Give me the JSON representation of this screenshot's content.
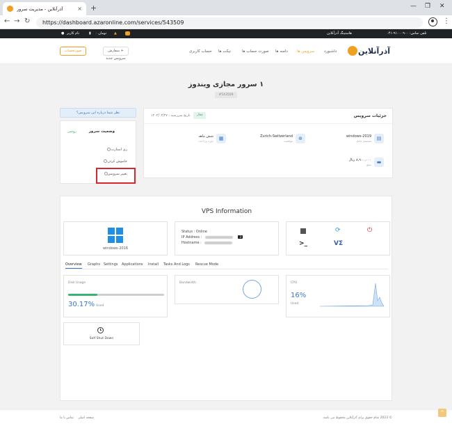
{
  "browser": {
    "tab_title": "آذرآنلاین - مدیریت سرور",
    "new_tab": "+",
    "url": "https://dashboard.azaronline.com/services/543509"
  },
  "topbar": {
    "phone": "تلفن تماس: ۹۱۰۰۰۹۰۰-۰۴۱",
    "hosting": "هاستینگ آذرآنلاین",
    "cart_count": "۰",
    "balance": "۰ تومان",
    "user": "نام کاربر"
  },
  "header": {
    "logo_text": "آذرآنلاین",
    "nav": [
      "داشبورد",
      "سرویس ها",
      "دامنه ها",
      "صورت حساب ها",
      "تیکت ها",
      "حساب کاربری"
    ],
    "order_button": "+ سفارش سرویس جدید",
    "invoice_button": "صورتحساب"
  },
  "page": {
    "title": "۱ سرور مجازی ویندوز",
    "service_id": "#543509"
  },
  "sidebar": {
    "help_button": "نظر شما درباره این سرویس؟",
    "status_title": "وضعیت سرور",
    "status_value": "روشن",
    "actions": [
      "ری استارت",
      "خاموش کردن",
      "تغییر سرویس"
    ]
  },
  "details": {
    "title": "جزئیات سرویس",
    "status_badge": "فعال",
    "date_label": "تاریخ سررسید : ۱۴۰۲/۰۳/۲۷",
    "specs": [
      {
        "value": "windows-2019",
        "label": "سیستم عامل",
        "icon": "os-icon"
      },
      {
        "value": "Zurich-Switzerland",
        "label": "موقعیت",
        "icon": "location-icon"
      },
      {
        "value": "شش ماهه",
        "label": "دوره پرداخت",
        "icon": "calendar-icon"
      },
      {
        "value": "۸,۹۰۰,۰۰۰ ریال",
        "label": "مبلغ",
        "icon": "money-icon"
      }
    ]
  },
  "vps": {
    "title": "VPS Information",
    "os_name": "windows-2016",
    "status_label": "Status :",
    "status_value": "Online",
    "ip_label": "IP Address :",
    "host_label": "Hostname :",
    "ip_badge": "3",
    "tabs": [
      "Overview",
      "Graphs",
      "Settings",
      "Applications",
      "Install",
      "Tasks And Logs",
      "Rescue Mode"
    ],
    "disk": {
      "label": "Disk Usage",
      "value": "30.17%",
      "unit": "Used",
      "fraction": 0.3017
    },
    "bandwidth": {
      "label": "Bandwidth"
    },
    "cpu": {
      "label": "CPU",
      "value": "16%",
      "unit": "Used"
    },
    "shutdown": {
      "label": "Self Shut Down"
    },
    "controls": {
      "console": ">_",
      "vnc": "VΣ"
    }
  },
  "footer": {
    "copyright": "© 2023 تمام حقوق برای آذرآنلاین محفوظ می باشد.",
    "links": [
      "صفحه اصلی",
      "تماس با ما"
    ],
    "scroll_top": "^"
  },
  "colors": {
    "accent": "#f0a020",
    "primary": "#3a78c9",
    "success": "#3cb371",
    "danger": "#d9252e"
  }
}
